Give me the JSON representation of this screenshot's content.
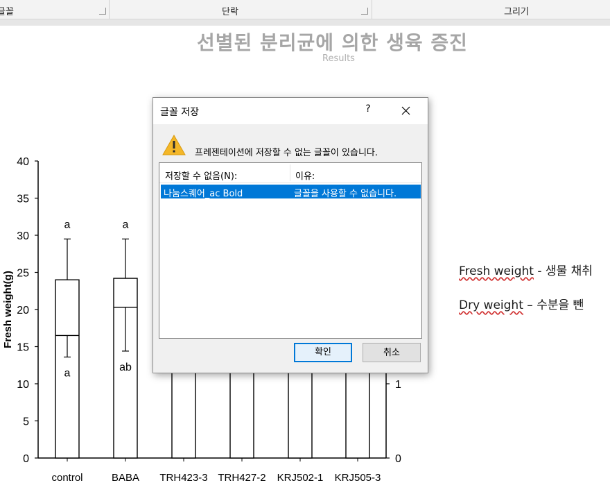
{
  "ribbon": {
    "groups": [
      {
        "label": "글꼴"
      },
      {
        "label": "단락"
      },
      {
        "label": "그리기"
      }
    ]
  },
  "slide": {
    "title": "선별된 분리균에 의한 생육 증진",
    "subtitle": "Results",
    "notes": [
      {
        "term": "Fresh weight",
        "sep": " - ",
        "desc": "생물 채취"
      },
      {
        "term": "Dry weight",
        "sep": " – ",
        "desc": "수분을 뺀"
      }
    ]
  },
  "dialog": {
    "title": "글꼴 저장",
    "help": "?",
    "message": "프레젠테이션에 저장할 수 없는 글꼴이 있습니다.",
    "columns": [
      "저장할 수 없음(N):",
      "이유:"
    ],
    "row": {
      "font": "나눔스퀘어_ac Bold",
      "reason": "글꼴을 사용할 수 없습니다."
    },
    "ok_label": "확인",
    "cancel_label": "취소"
  },
  "chart_data": {
    "type": "bar",
    "ylabel": "Fresh weight(g)",
    "ylim": [
      0,
      40
    ],
    "yticks": [
      "0",
      "5",
      "10",
      "15",
      "20",
      "25",
      "30",
      "35",
      "40"
    ],
    "categories": [
      "control",
      "BABA",
      "TRH423-3",
      "TRH427-2",
      "KRJ502-1",
      "KRJ505-3"
    ],
    "series": [
      {
        "values": [
          24,
          24.2,
          null,
          null,
          null,
          null
        ],
        "errors": [
          5.5,
          5.3,
          null,
          null,
          null,
          null
        ],
        "letters": [
          "a",
          "a",
          "",
          "",
          "",
          ""
        ]
      },
      {
        "values": [
          16.5,
          20.3,
          null,
          null,
          null,
          null
        ],
        "errors": [
          2.9,
          5.9,
          null,
          null,
          null,
          null
        ],
        "letters": [
          "a",
          "ab",
          "",
          "",
          "",
          ""
        ]
      }
    ],
    "right_axis_ticks": [
      "0",
      "1"
    ]
  }
}
